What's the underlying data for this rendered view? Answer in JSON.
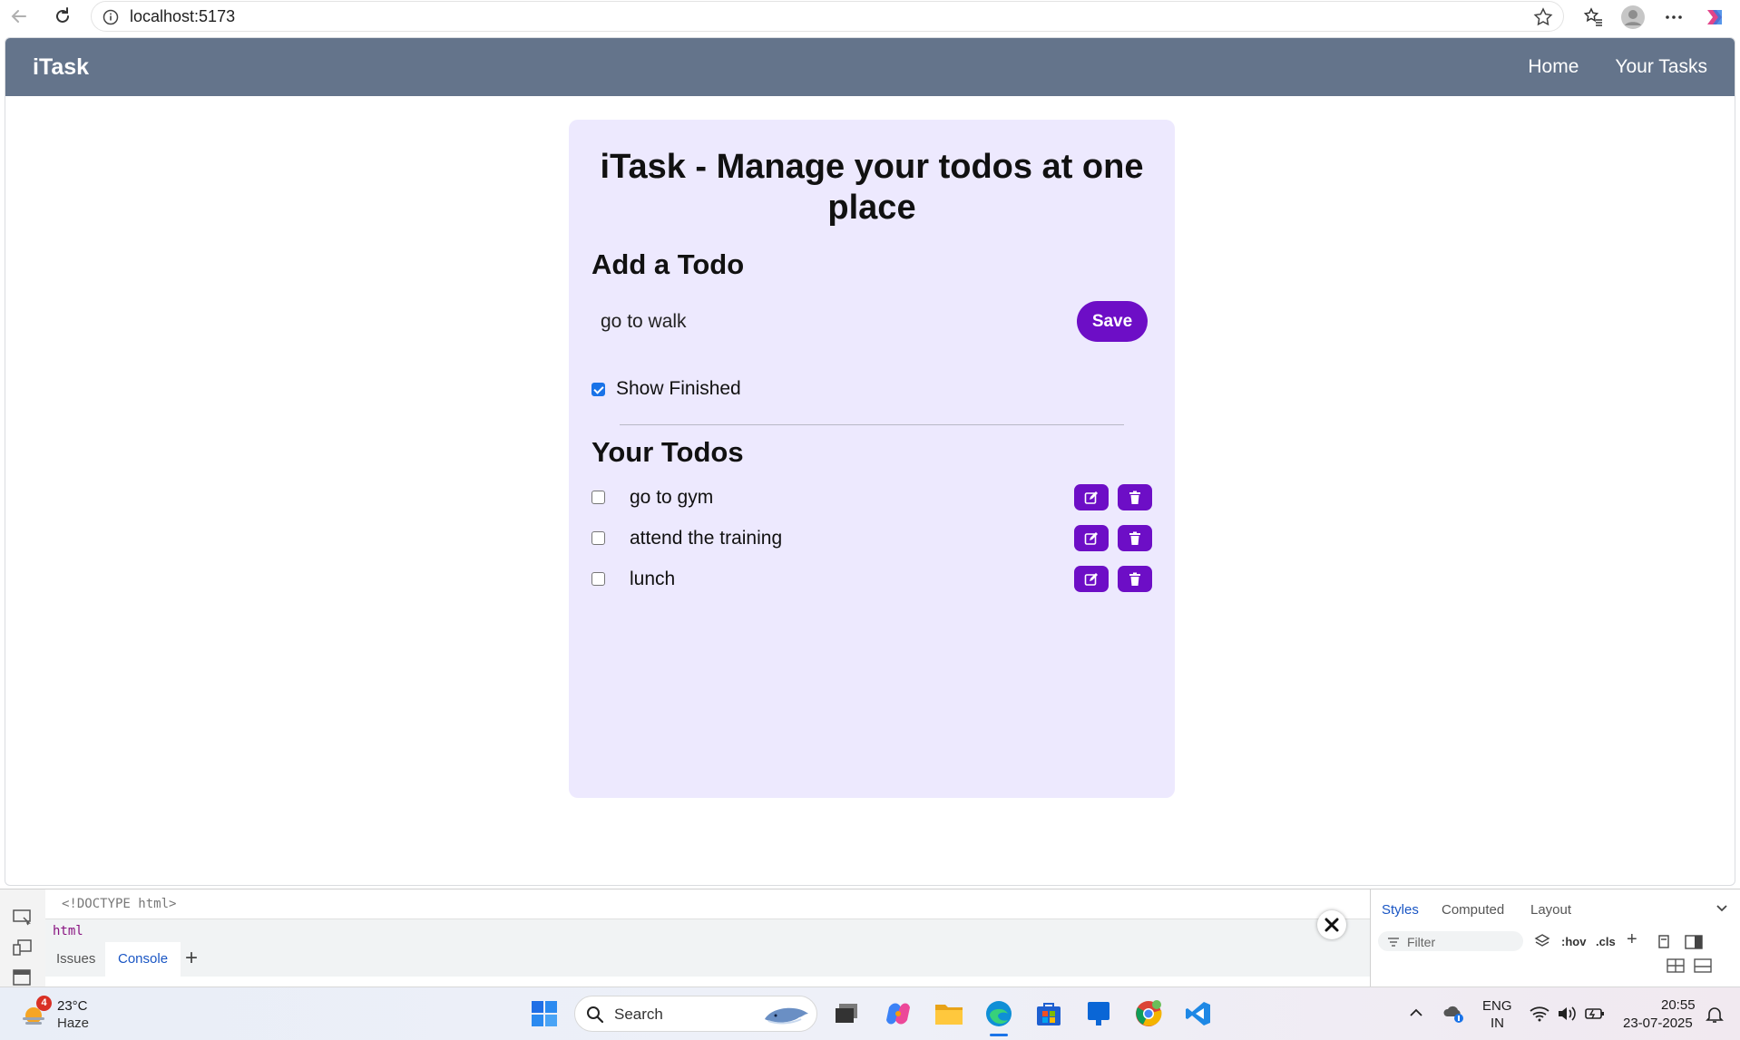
{
  "browser": {
    "url": "localhost:5173"
  },
  "app": {
    "brand": "iTask",
    "nav": [
      {
        "label": "Home"
      },
      {
        "label": "Your Tasks"
      }
    ],
    "title": "iTask - Manage your todos at one place",
    "add_heading": "Add a Todo",
    "input_value": "go to walk",
    "save_label": "Save",
    "show_finished_label": "Show Finished",
    "show_finished_checked": true,
    "todos_heading": "Your Todos",
    "todos": [
      {
        "text": "go to gym",
        "done": false
      },
      {
        "text": "attend the training",
        "done": false
      },
      {
        "text": "lunch",
        "done": false
      }
    ],
    "accent_color": "#6d0ec6",
    "nav_color": "#64748b",
    "card_color": "#ede9fe"
  },
  "devtools": {
    "code_line": "<!DOCTYPE html>",
    "breadcrumb": "html",
    "tabs": [
      {
        "label": "Issues"
      },
      {
        "label": "Console",
        "active": true
      }
    ],
    "right_tabs": [
      {
        "label": "Styles",
        "active": true
      },
      {
        "label": "Computed"
      },
      {
        "label": "Layout"
      }
    ],
    "filter_placeholder": "Filter",
    "hov_label": ":hov",
    "cls_label": ".cls"
  },
  "taskbar": {
    "weather_temp": "23°C",
    "weather_condition": "Haze",
    "weather_badge": "4",
    "search_label": "Search",
    "lang_line1": "ENG",
    "lang_line2": "IN",
    "time": "20:55",
    "date": "23-07-2025"
  }
}
